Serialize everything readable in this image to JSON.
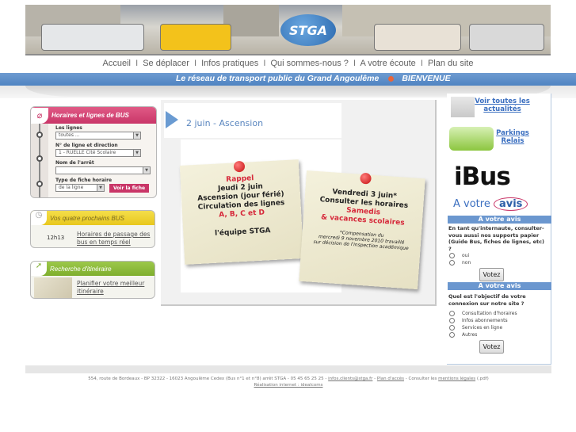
{
  "header": {
    "logo_text": "STGA"
  },
  "nav": {
    "items": [
      "Accueil",
      "Se déplacer",
      "Infos pratiques",
      "Qui sommes-nous ?",
      "A votre écoute",
      "Plan du site"
    ],
    "separator": "I"
  },
  "band": {
    "tagline": "Le réseau de transport public du Grand Angoulême",
    "welcome": "BIENVENUE"
  },
  "horaires": {
    "title": "Horaires et lignes de BUS",
    "lines_label": "Les lignes",
    "lines_value": "toutes ...",
    "direction_label": "N° de ligne et direction",
    "direction_value": "1 - RUELLE Cité Scolaire",
    "stop_label": "Nom de l'arrêt",
    "stop_value": "",
    "type_label": "Type de fiche horaire",
    "type_value": "de la ligne",
    "submit_label": "Voir la fiche"
  },
  "prochains": {
    "title": "Vos quatre prochains BUS",
    "time": "12h13",
    "link": "Horaires de passage des bus en temps réel"
  },
  "itineraire": {
    "title": "Recherche d'itinéraire",
    "link": "Planifier votre meilleur itinéraire"
  },
  "news": {
    "title": "2 juin - Ascension",
    "note1": [
      "Rappel",
      "Jeudi 2 juin",
      "Ascension (jour férié)",
      "Circulation des lignes",
      "A, B, C et D",
      "l'équipe STGA"
    ],
    "note2": [
      "Vendredi 3 juin*",
      "Consulter les horaires",
      "Samedis",
      "& vacances scolaires",
      "*Compensation du",
      "mercredi 9 novembre 2010 travaillé",
      "sur décision de l'inspection académique"
    ]
  },
  "right": {
    "actualites_link": "Voir toutes les actualités",
    "parkings_link": "Parkings Relais",
    "ibus": "iBus",
    "avis_logo_a": "A votre",
    "avis_logo_b": "avis",
    "poll1": {
      "head": "A votre avis",
      "question": "En tant qu'internaute, consulter-vous aussi nos supports papier (Guide Bus, fiches de lignes, etc) ?",
      "options": [
        "oui",
        "non"
      ],
      "vote_label": "Votez"
    },
    "poll2": {
      "head": "A votre avis",
      "question": "Quel est l'objectif de votre connexion sur notre site ?",
      "options": [
        "Consultation d'horaires",
        "Infos abonnements",
        "Services en ligne",
        "Autres"
      ],
      "vote_label": "Votez"
    }
  },
  "footer": {
    "address": "554, route de Bordeaux - BP 32322 - 16023 Angoulême Cedex (Bus n°1 et n°8) arrêt STGA - 05 45 65 25 25 -",
    "email": "infos.clients@stga.fr",
    "sep1": "-",
    "plan_acces": "Plan d'accès",
    "consult": "- Consulter les",
    "mentions": "mentions légales",
    "pdf": "(.pdf)",
    "realisation": "Réalisation internet : idealcoms"
  }
}
